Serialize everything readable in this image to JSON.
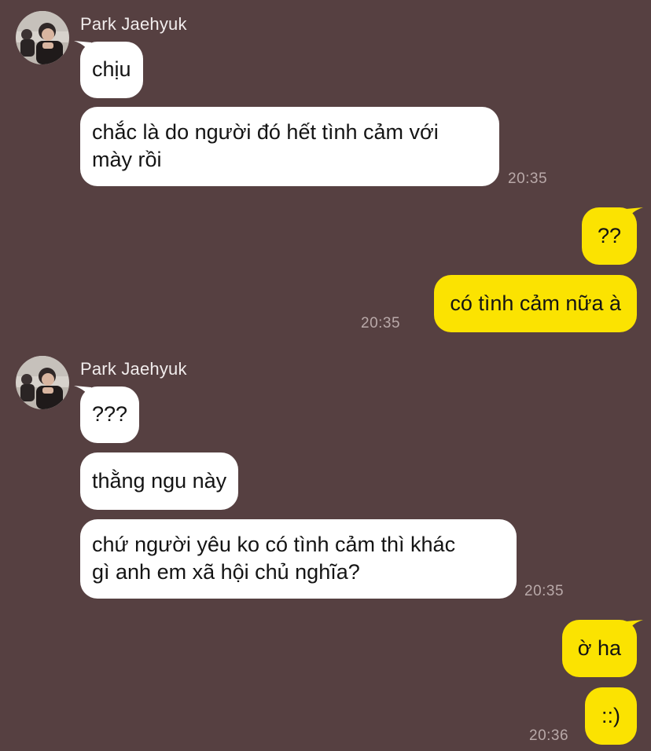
{
  "colors": {
    "background": "#564041",
    "incoming_bubble": "#ffffff",
    "outgoing_bubble": "#fbe301",
    "timestamp": "#b9a9a9",
    "sender_name": "#f1ecec"
  },
  "messages": [
    {
      "sender": "Park Jaehyuk",
      "avatar_icon": "profile-photo",
      "bubbles": [
        "chịu",
        "chắc là do người đó hết tình cảm với\nmày rồi"
      ],
      "time": "20:35"
    },
    {
      "sender": "me",
      "bubbles": [
        "??",
        "có tình cảm nữa à"
      ],
      "time": "20:35"
    },
    {
      "sender": "Park Jaehyuk",
      "avatar_icon": "profile-photo",
      "bubbles": [
        "???",
        "thằng ngu này",
        "chứ người yêu ko có tình cảm thì khác\ngì anh em xã hội chủ nghĩa?"
      ],
      "time": "20:35"
    },
    {
      "sender": "me",
      "bubbles": [
        "ờ ha",
        "::)"
      ],
      "time": "20:36"
    }
  ]
}
